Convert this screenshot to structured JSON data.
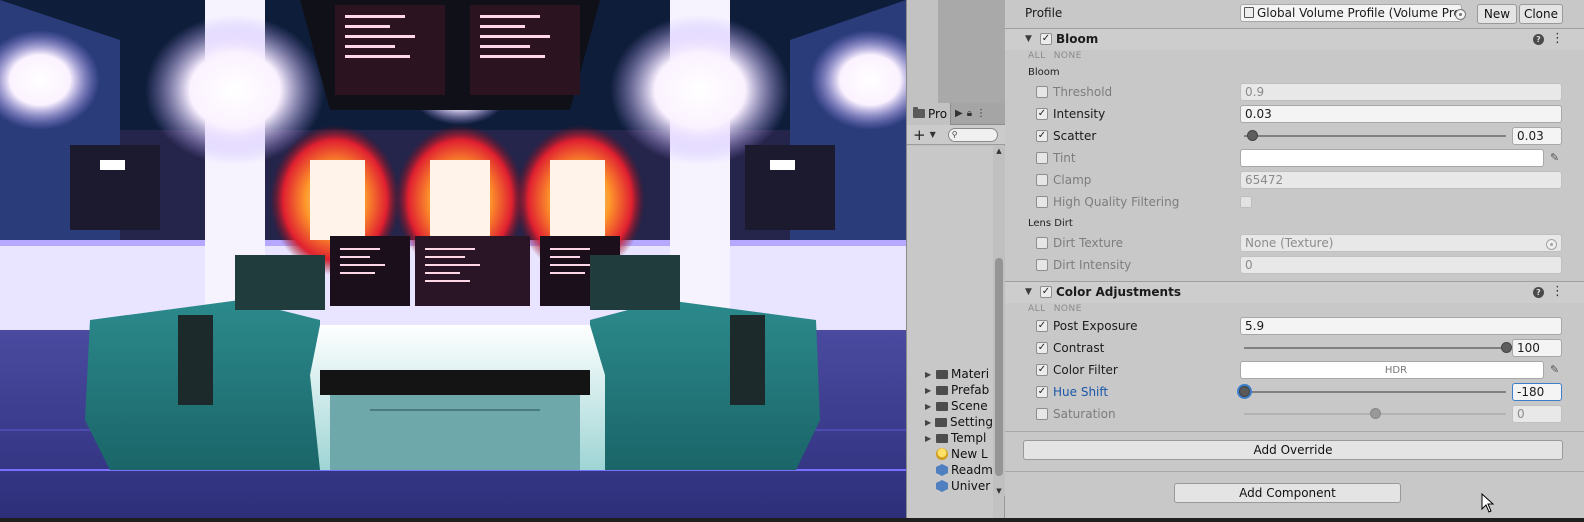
{
  "project": {
    "tab_label": "Pro",
    "search_placeholder": "",
    "items": [
      {
        "label": "Materi",
        "type": "folder"
      },
      {
        "label": "Prefab",
        "type": "folder"
      },
      {
        "label": "Scene",
        "type": "folder"
      },
      {
        "label": "Setting",
        "type": "folder"
      },
      {
        "label": "Templ",
        "type": "folder"
      },
      {
        "label": "New L",
        "type": "light"
      },
      {
        "label": "Readm",
        "type": "asset"
      },
      {
        "label": "Univer",
        "type": "asset"
      }
    ]
  },
  "inspector": {
    "profile_label": "Profile",
    "profile_value": "Global Volume Profile (Volume Profi",
    "new_button": "New",
    "clone_button": "Clone",
    "bloom": {
      "title": "Bloom",
      "enabled": true,
      "all": "ALL",
      "none": "NONE",
      "section_bloom": "Bloom",
      "threshold_label": "Threshold",
      "threshold_value": "0.9",
      "threshold_override": false,
      "intensity_label": "Intensity",
      "intensity_value": "0.03",
      "intensity_override": true,
      "scatter_label": "Scatter",
      "scatter_value": "0.03",
      "scatter_fraction": 0.03,
      "scatter_override": true,
      "tint_label": "Tint",
      "tint_override": false,
      "clamp_label": "Clamp",
      "clamp_value": "65472",
      "clamp_override": false,
      "hq_label": "High Quality Filtering",
      "hq_override": false,
      "section_lens": "Lens Dirt",
      "dirt_texture_label": "Dirt Texture",
      "dirt_texture_value": "None (Texture)",
      "dirt_texture_override": false,
      "dirt_intensity_label": "Dirt Intensity",
      "dirt_intensity_value": "0",
      "dirt_intensity_override": false
    },
    "color_adjustments": {
      "title": "Color Adjustments",
      "enabled": true,
      "all": "ALL",
      "none": "NONE",
      "post_exposure_label": "Post Exposure",
      "post_exposure_value": "5.9",
      "post_exposure_override": true,
      "contrast_label": "Contrast",
      "contrast_value": "100",
      "contrast_fraction": 1.0,
      "contrast_override": true,
      "color_filter_label": "Color Filter",
      "color_filter_hdr": "HDR",
      "color_filter_override": true,
      "hue_shift_label": "Hue Shift",
      "hue_shift_value": "-180",
      "hue_shift_fraction": 0.0,
      "hue_shift_override": true,
      "saturation_label": "Saturation",
      "saturation_value": "0",
      "saturation_fraction": 0.5,
      "saturation_override": false
    },
    "add_override_button": "Add Override",
    "add_component_button": "Add Component"
  },
  "colors": {
    "accent_blue": "#3c7ec9",
    "hue_label_blue": "#1a56a8"
  }
}
